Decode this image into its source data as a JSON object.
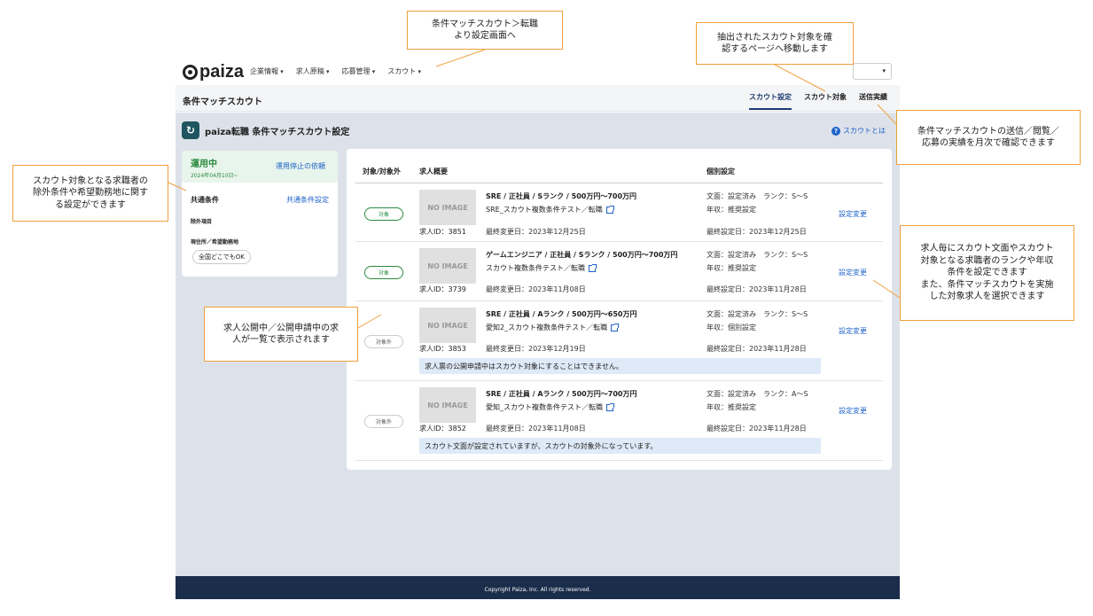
{
  "header": {
    "logo_text": "paiza",
    "nav": [
      "企業情報",
      "求人原稿",
      "応募管理",
      "スカウト"
    ],
    "select_indicator": "▾"
  },
  "subheader": {
    "title": "条件マッチスカウト",
    "tabs": [
      {
        "label": "スカウト設定",
        "active": true
      },
      {
        "label": "スカウト対象",
        "active": false
      },
      {
        "label": "送信実績",
        "active": false
      }
    ]
  },
  "page": {
    "title": "paiza転職 条件マッチスカウト設定",
    "help_label": "スカウトとは"
  },
  "left_panel": {
    "status": "運用中",
    "status_date": "2024年04月10日~",
    "stop_link": "運用停止の依頼",
    "common_label": "共通条件",
    "common_link": "共通条件設定",
    "exclude_label": "除外項目",
    "location_label": "現住所／希望勤務地",
    "location_chip": "全国どこでもOK"
  },
  "table": {
    "col_target": "対象/対象外",
    "col_summary": "求人概要",
    "col_individual": "個別設定",
    "no_image": "NO IMAGE",
    "edit_label": "設定変更",
    "rows": [
      {
        "badge": "対象",
        "badge_on": true,
        "title": "SRE / 正社員 / Sランク / 500万円〜700万円",
        "sub": "SRE_スカウト複数条件テスト／転職",
        "id": "求人ID：3851",
        "modified": "最終変更日：2023年12月25日",
        "ind1": "文面：設定済み　ランク：S〜S",
        "ind2": "年収：推奨設定",
        "ind3": "最終設定日：2023年12月25日",
        "notice": ""
      },
      {
        "badge": "対象",
        "badge_on": true,
        "title": "ゲームエンジニア / 正社員 / Sランク / 500万円〜700万円",
        "sub": "スカウト複数条件テスト／転職",
        "id": "求人ID：3739",
        "modified": "最終変更日：2023年11月08日",
        "ind1": "文面：設定済み　ランク：S〜S",
        "ind2": "年収：推奨設定",
        "ind3": "最終設定日：2023年11月28日",
        "notice": ""
      },
      {
        "badge": "対象外",
        "badge_on": false,
        "title": "SRE / 正社員 / Aランク / 500万円〜650万円",
        "sub": "愛知2_スカウト複数条件テスト／転職",
        "id": "求人ID：3853",
        "modified": "最終変更日：2023年12月19日",
        "ind1": "文面：設定済み　ランク：S〜S",
        "ind2": "年収：個別設定",
        "ind3": "最終設定日：2023年11月28日",
        "notice": "求人票の公開申請中はスカウト対象にすることはできません。"
      },
      {
        "badge": "対象外",
        "badge_on": false,
        "title": "SRE / 正社員 / Aランク / 500万円〜700万円",
        "sub": "愛知_スカウト複数条件テスト／転職",
        "id": "求人ID：3852",
        "modified": "最終変更日：2023年11月08日",
        "ind1": "文面：設定済み　ランク：A〜S",
        "ind2": "年収：推奨設定",
        "ind3": "最終設定日：2023年11月28日",
        "notice": "スカウト文面が設定されていますが、スカウトの対象外になっています。"
      }
    ]
  },
  "footer": "Copyright Paiza, Inc. All rights reserved.",
  "callouts": {
    "nav": "条件マッチスカウト＞転職\nより設定画面へ",
    "target_page": "抽出されたスカウト対象を確\n認するページへ移動します",
    "results": "条件マッチスカウトの送信／閲覧／\n応募の実績を月次で確認できます",
    "left": "スカウト対象となる求職者の\n除外条件や希望勤務地に関す\nる設定ができます",
    "list": "求人公開中／公開申請中の求\n人が一覧で表示されます",
    "right": "求人毎にスカウト文面やスカウト\n対象となる求職者のランクや年収\n条件を設定できます\nまた、条件マッチスカウトを実施\nした対象求人を選択できます"
  },
  "colors": {
    "accent": "#1d62c9",
    "active_tab": "#1c3b6e",
    "status_green": "#2a8a3e",
    "callout_border": "#f0a03c",
    "footer_bg": "#1a2d4a"
  }
}
